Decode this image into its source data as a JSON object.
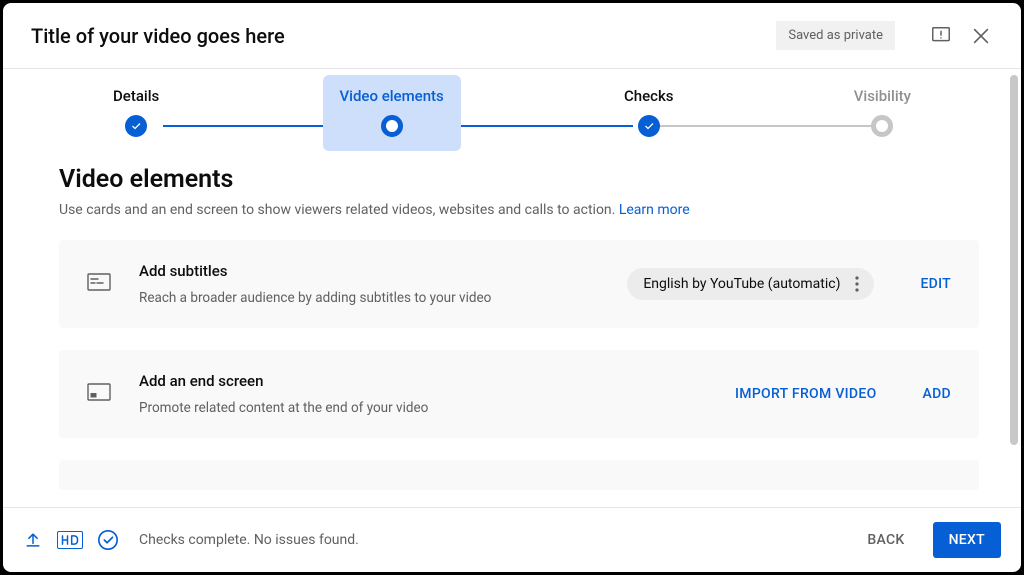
{
  "header": {
    "title": "Title of your video goes here",
    "saved_badge": "Saved as private"
  },
  "stepper": {
    "steps": [
      {
        "label": "Details",
        "state": "done"
      },
      {
        "label": "Video elements",
        "state": "active"
      },
      {
        "label": "Checks",
        "state": "done"
      },
      {
        "label": "Visibility",
        "state": "todo"
      }
    ]
  },
  "section": {
    "title": "Video elements",
    "subtitle": "Use cards and an end screen to show viewers related videos, websites and calls to action. ",
    "learn_more": "Learn more"
  },
  "cards": {
    "subtitles": {
      "title": "Add subtitles",
      "desc": "Reach a broader audience by adding subtitles to your video",
      "chip": "English by YouTube (automatic)",
      "action": "EDIT"
    },
    "endscreen": {
      "title": "Add an end screen",
      "desc": "Promote related content at the end of your video",
      "import_action": "IMPORT FROM VIDEO",
      "add_action": "ADD"
    }
  },
  "footer": {
    "status": "Checks complete. No issues found.",
    "back": "BACK",
    "next": "NEXT"
  }
}
